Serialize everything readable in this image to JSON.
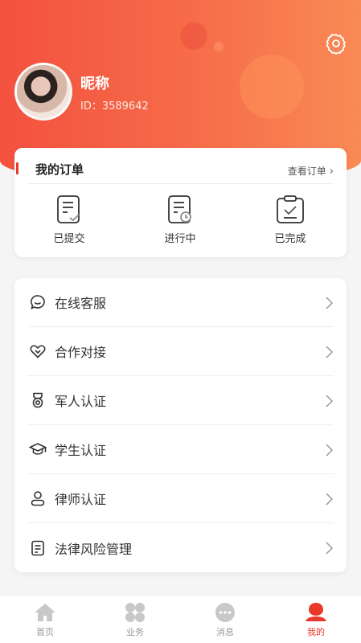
{
  "colors": {
    "accent": "#e8392a",
    "header_start": "#f3513f",
    "header_end": "#f98a55"
  },
  "profile": {
    "nickname": "昵称",
    "id_text": "ID：3589642"
  },
  "orders": {
    "title": "我的订单",
    "view_all": "查看订单",
    "items": [
      {
        "label": "已提交",
        "icon": "submitted-doc-icon"
      },
      {
        "label": "进行中",
        "icon": "in-progress-doc-icon"
      },
      {
        "label": "已完成",
        "icon": "completed-clipboard-icon"
      }
    ]
  },
  "menu": [
    {
      "label": "在线客服",
      "icon": "chat-service-icon"
    },
    {
      "label": "合作对接",
      "icon": "handshake-heart-icon"
    },
    {
      "label": "军人认证",
      "icon": "medal-icon"
    },
    {
      "label": "学生认证",
      "icon": "graduation-cap-icon"
    },
    {
      "label": "律师认证",
      "icon": "person-icon"
    },
    {
      "label": "法律风险管理",
      "icon": "document-icon"
    }
  ],
  "tabs": [
    {
      "label": "首页",
      "icon": "home-icon"
    },
    {
      "label": "业务",
      "icon": "business-grid-icon"
    },
    {
      "label": "消息",
      "icon": "message-icon"
    },
    {
      "label": "我的",
      "icon": "profile-icon",
      "active": true
    }
  ]
}
